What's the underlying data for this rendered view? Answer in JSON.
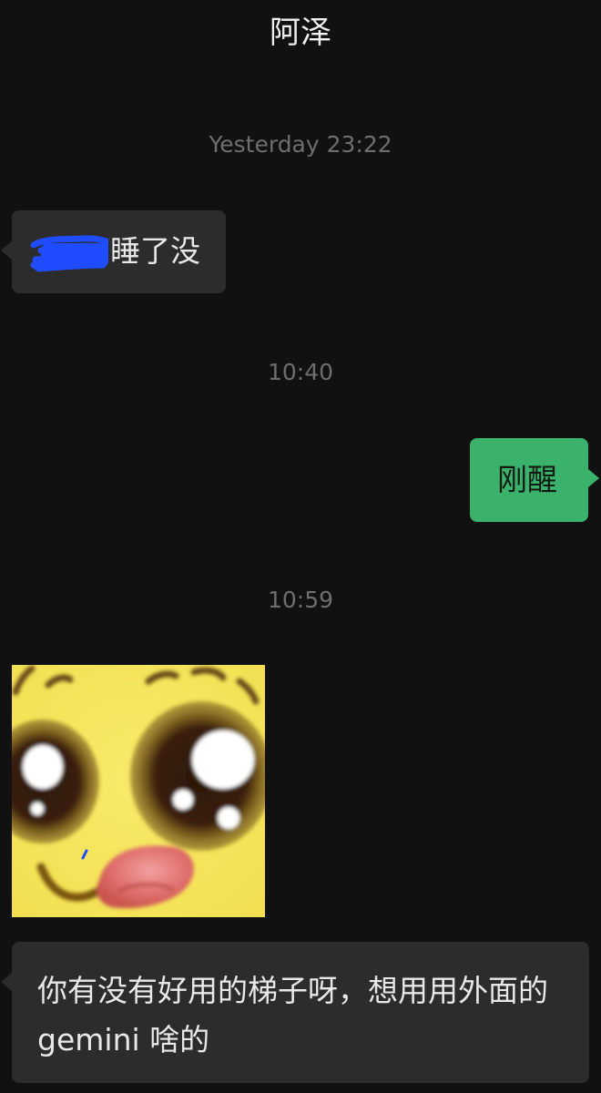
{
  "header": {
    "title": "阿泽"
  },
  "messages": [
    {
      "time": "Yesterday 23:22",
      "direction": "incoming",
      "text": "睡了没",
      "redacted_prefix": true
    },
    {
      "time": "10:40",
      "direction": "outgoing",
      "text": "刚醒"
    },
    {
      "time": "10:59",
      "direction": "incoming",
      "type": "sticker",
      "sticker": "cute-duck-face-close-up"
    },
    {
      "direction": "incoming",
      "text": "你有没有好用的梯子呀，想用用外面的 gemini 啥的"
    }
  ],
  "colors": {
    "background": "#111111",
    "incoming_bubble": "#2c2c2c",
    "outgoing_bubble": "#3bb26b",
    "timestamp": "#6e6e6e",
    "redaction_scribble": "#1f4cff"
  }
}
